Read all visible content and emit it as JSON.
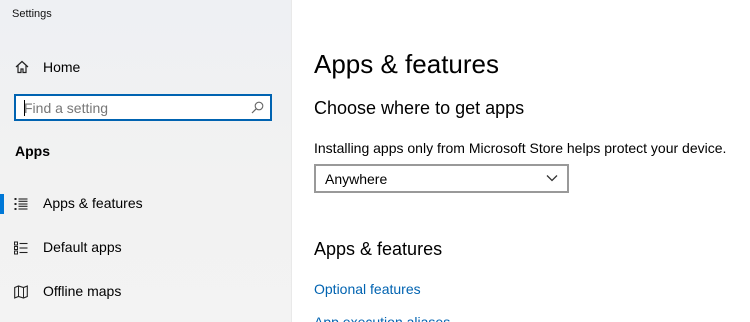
{
  "window": {
    "title": "Settings"
  },
  "nav": {
    "home_label": "Home",
    "search": {
      "placeholder": "Find a setting",
      "value": ""
    },
    "section_label": "Apps",
    "items": [
      {
        "label": "Apps & features",
        "icon": "list-icon",
        "selected": true
      },
      {
        "label": "Default apps",
        "icon": "default-apps-icon",
        "selected": false
      },
      {
        "label": "Offline maps",
        "icon": "map-icon",
        "selected": false
      }
    ]
  },
  "main": {
    "title": "Apps & features",
    "choose_heading": "Choose where to get apps",
    "install_desc": "Installing apps only from Microsoft Store helps protect your device.",
    "app_source": {
      "selected": "Anywhere"
    },
    "apps_heading": "Apps & features",
    "links": {
      "optional_features": "Optional features",
      "app_execution_aliases": "App execution aliases"
    }
  },
  "colors": {
    "accent": "#0078d7",
    "link": "#0063b1",
    "nav_bg": "#f2f2f2"
  }
}
